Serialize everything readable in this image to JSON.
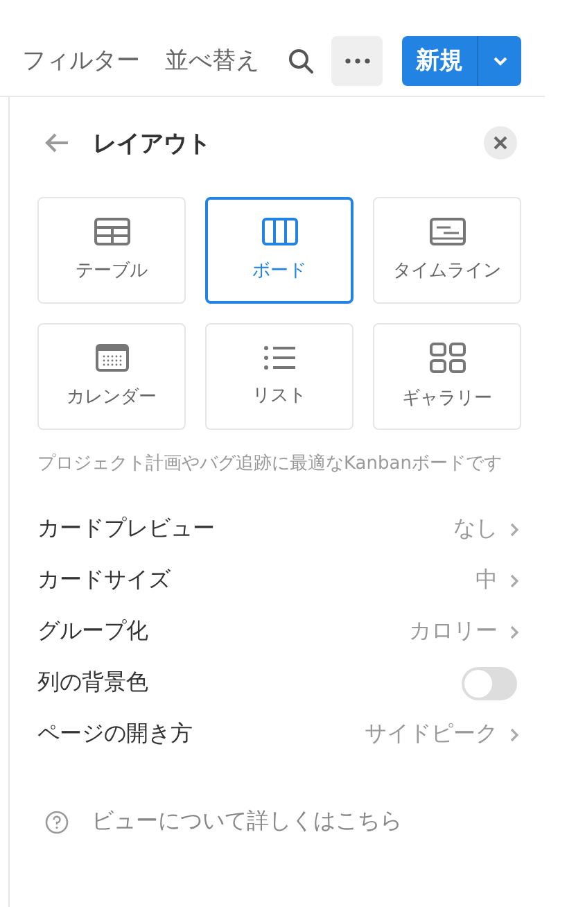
{
  "toolbar": {
    "filter": "フィルター",
    "sort": "並べ替え",
    "new_button": "新規"
  },
  "panel": {
    "title": "レイアウト",
    "layouts": [
      {
        "kind": "table",
        "label": "テーブル",
        "selected": false
      },
      {
        "kind": "board",
        "label": "ボード",
        "selected": true
      },
      {
        "kind": "timeline",
        "label": "タイムライン",
        "selected": false
      },
      {
        "kind": "calendar",
        "label": "カレンダー",
        "selected": false
      },
      {
        "kind": "list",
        "label": "リスト",
        "selected": false
      },
      {
        "kind": "gallery",
        "label": "ギャラリー",
        "selected": false
      }
    ],
    "description": "プロジェクト計画やバグ追跡に最適なKanbanボードです",
    "settings": [
      {
        "kind": "value",
        "label": "カードプレビュー",
        "value": "なし"
      },
      {
        "kind": "value",
        "label": "カードサイズ",
        "value": "中"
      },
      {
        "kind": "value",
        "label": "グループ化",
        "value": "カロリー"
      },
      {
        "kind": "toggle",
        "label": "列の背景色",
        "on": false
      },
      {
        "kind": "value",
        "label": "ページの開き方",
        "value": "サイドピーク"
      }
    ],
    "help_link": "ビューについて詳しくはこちら"
  }
}
